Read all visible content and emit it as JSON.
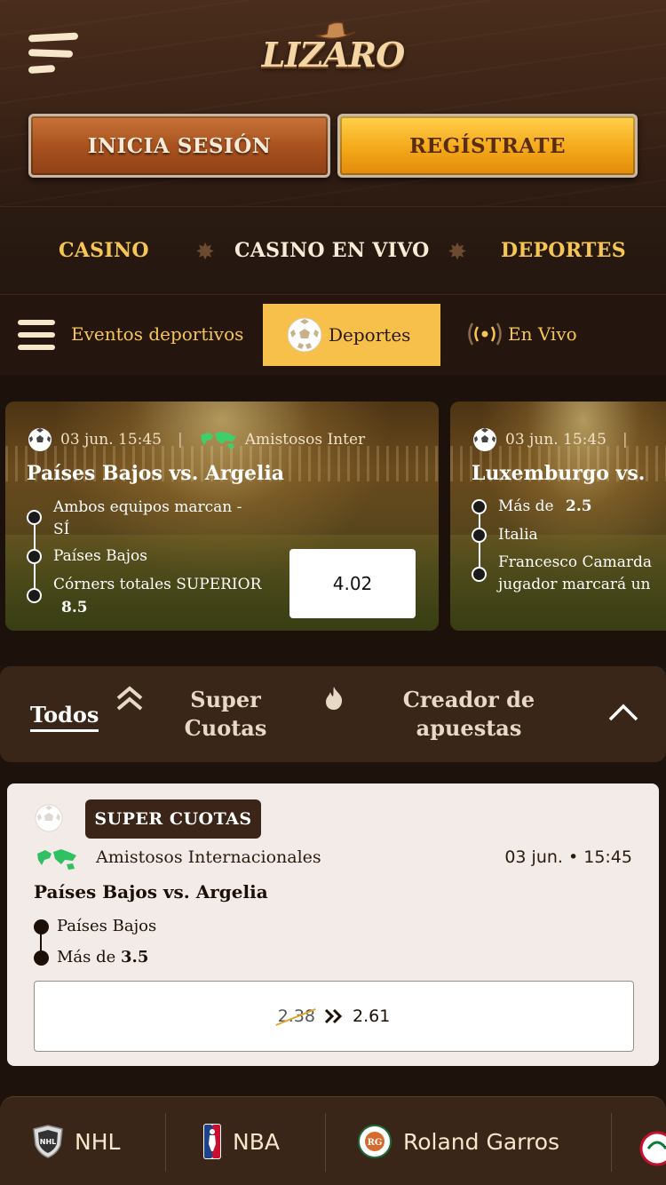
{
  "header": {
    "logo_text": "LIZARO",
    "login_label": "INICIA SESIÓN",
    "register_label": "REGÍSTRATE"
  },
  "nav": {
    "casino": "CASINO",
    "casino_live": "CASINO EN VIVO",
    "sports": "DEPORTES"
  },
  "subbar": {
    "events": "Eventos deportivos",
    "sports": "Deportes",
    "live": "En Vivo"
  },
  "event_cards": [
    {
      "date": "03 jun. 15:45",
      "league": "Amistosos Inter",
      "title": "Países Bajos vs. Argelia",
      "selections": [
        "Ambos equipos marcan -",
        "SÍ",
        "Países Bajos",
        "Córners totales SUPERIOR",
        "8.5"
      ],
      "odds": "4.02"
    },
    {
      "date": "03 jun. 15:45",
      "title": "Luxemburgo vs.",
      "selections": [
        "Más de",
        "2.5",
        "Italia",
        "Francesco Camarda",
        "jugador marcará un"
      ]
    }
  ],
  "filters": {
    "all": "Todos",
    "super_line1": "Super",
    "super_line2": "Cuotas",
    "creator_line1": "Creador de",
    "creator_line2": "apuestas"
  },
  "super_card": {
    "badge": "SUPER CUOTAS",
    "league": "Amistosos Internacionales",
    "date": "03 jun. • 15:45",
    "title": "Países Bajos vs. Argelia",
    "sel1": "Países Bajos",
    "sel2_prefix": "Más de",
    "sel2_value": "3.5",
    "old_odds": "2.38",
    "new_odds": "2.61"
  },
  "leagues": [
    "NHL",
    "NBA",
    "Roland Garros"
  ],
  "colors": {
    "accent_gold": "#f6c654",
    "button_yellow": "#f7c04a",
    "brown_dark": "#24160f",
    "card_bg": "#f3ebe7"
  }
}
